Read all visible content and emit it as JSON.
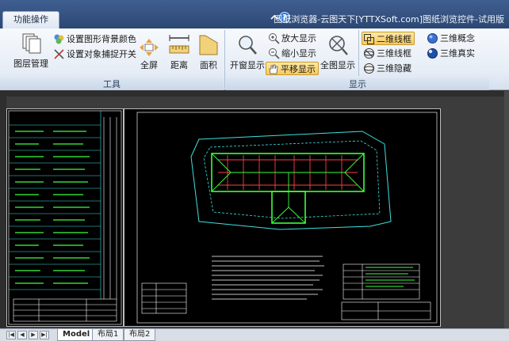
{
  "window": {
    "tab_label": "功能操作",
    "title": "图纸浏览器-云图天下[YTTXSoft.com]图纸浏览控件-试用版"
  },
  "ribbon": {
    "tools_group": {
      "label": "工具",
      "layer_manage": "图层管理",
      "set_bg_color": "设置图形背景颜色",
      "set_snap": "设置对象捕捉开关",
      "fullscreen": "全屏",
      "distance": "距离",
      "area": "面积"
    },
    "display_group": {
      "label": "显示",
      "window_zoom": "开窗显示",
      "zoom_in": "放大显示",
      "zoom_out": "缩小显示",
      "pan": "平移显示",
      "zoom_all": "全图显示",
      "wireframe_2d": "二维线框",
      "wireframe_3d": "三维线框",
      "hidden_3d": "三维隐藏",
      "concept_3d": "三维概念",
      "realistic_3d": "三维真实"
    }
  },
  "layout_tabs": [
    "Model",
    "布局1",
    "布局2"
  ],
  "active_layout": "Model",
  "colors": {
    "titlebar": "#2c4773",
    "ribbon_bg": "#e6edf6",
    "active_button": "#f7c95c",
    "drawing_bg": "#000000",
    "cad_green": "#3cff3c",
    "cad_red": "#ff4040",
    "cad_cyan": "#40e0e0"
  }
}
